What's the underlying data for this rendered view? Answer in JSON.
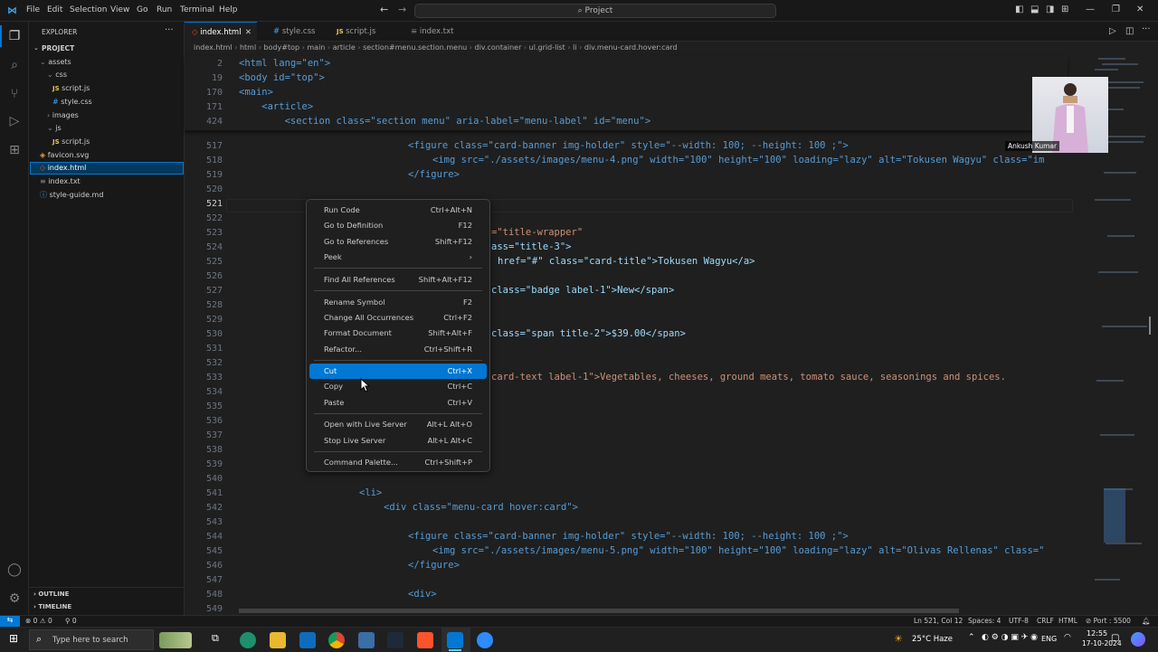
{
  "menubar": {
    "items": [
      "File",
      "Edit",
      "Selection",
      "View",
      "Go",
      "Run",
      "Terminal",
      "Help"
    ],
    "search": "Project"
  },
  "explorer": {
    "title": "EXPLORER",
    "project": "PROJECT",
    "items": [
      {
        "label": "assets",
        "kind": "folder"
      },
      {
        "label": "css",
        "kind": "folder"
      },
      {
        "label": "script.js",
        "kind": "js"
      },
      {
        "label": "style.css",
        "kind": "css"
      },
      {
        "label": "images",
        "kind": "folder"
      },
      {
        "label": "js",
        "kind": "folder"
      },
      {
        "label": "script.js",
        "kind": "js"
      },
      {
        "label": "favicon.svg",
        "kind": "svg"
      },
      {
        "label": "index.html",
        "kind": "html"
      },
      {
        "label": "index.txt",
        "kind": "txt"
      },
      {
        "label": "style-guide.md",
        "kind": "md"
      }
    ],
    "outline": "OUTLINE",
    "timeline": "TIMELINE"
  },
  "tabs": [
    "index.html",
    "style.css",
    "script.js",
    "index.txt"
  ],
  "breadcrumb": [
    "index.html",
    "html",
    "body#top",
    "main",
    "article",
    "section#menu.section.menu",
    "div.container",
    "ul.grid-list",
    "li",
    "div.menu-card.hover:card"
  ],
  "sticky": {
    "lines": [
      "2",
      "19",
      "170",
      "171",
      "424"
    ],
    "code": [
      "<html lang=\"en\">",
      "<body id=\"top\">",
      "<main>",
      "    <article>",
      "        <section class=\"section menu\" aria-label=\"menu-label\" id=\"menu\">"
    ]
  },
  "gutter": [
    "517",
    "518",
    "519",
    "520",
    "521",
    "522",
    "523",
    "524",
    "525",
    "526",
    "527",
    "528",
    "529",
    "530",
    "531",
    "532",
    "533",
    "534",
    "535",
    "536",
    "537",
    "538",
    "539",
    "540",
    "541",
    "542",
    "543",
    "544",
    "545",
    "546",
    "547",
    "548",
    "549"
  ],
  "code_lines": {
    "l517": "<figure class=\"card-banner img-holder\" style=\"--width: 100; --height: 100 ;\">",
    "l518": "<img src=\"./assets/images/menu-4.png\" width=\"100\" height=\"100\" loading=\"lazy\" alt=\"Tokusen Wagyu\" class=\"im",
    "l519": "</figure>",
    "l522": "=\"title-wrapper\"",
    "l523": "ass=\"title-3\">",
    "l524": "href=\"#\" class=\"card-title\">Tokusen Wagyu</a>",
    "l526": "class=\"badge label-1\">New</span>",
    "l529": "class=\"span title-2\">$39.00</span>",
    "l532": "card-text label-1\">Vegetables, cheeses, ground meats, tomato sauce, seasonings and spices.",
    "l540": "<li>",
    "l541": "<div class=\"menu-card hover:card\">",
    "l543": "<figure class=\"card-banner img-holder\" style=\"--width: 100; --height: 100 ;\">",
    "l544": "<img src=\"./assets/images/menu-5.png\" width=\"100\" height=\"100\" loading=\"lazy\" alt=\"Olivas Rellenas\" class=\"",
    "l545": "</figure>",
    "l547": "<div>"
  },
  "context_menu": [
    {
      "label": "Run Code",
      "key": "Ctrl+Alt+N"
    },
    {
      "label": "Go to Definition",
      "key": "F12"
    },
    {
      "label": "Go to References",
      "key": "Shift+F12"
    },
    {
      "label": "Peek",
      "key": ""
    },
    {
      "label": "Find All References",
      "key": "Shift+Alt+F12"
    },
    {
      "label": "Rename Symbol",
      "key": "F2"
    },
    {
      "label": "Change All Occurrences",
      "key": "Ctrl+F2"
    },
    {
      "label": "Format Document",
      "key": "Shift+Alt+F"
    },
    {
      "label": "Refactor...",
      "key": "Ctrl+Shift+R"
    },
    {
      "label": "Cut",
      "key": "Ctrl+X"
    },
    {
      "label": "Copy",
      "key": "Ctrl+C"
    },
    {
      "label": "Paste",
      "key": "Ctrl+V"
    },
    {
      "label": "Open with Live Server",
      "key": "Alt+L Alt+O"
    },
    {
      "label": "Stop Live Server",
      "key": "Alt+L Alt+C"
    },
    {
      "label": "Command Palette...",
      "key": "Ctrl+Shift+P"
    }
  ],
  "webcam": {
    "name": "Ankush Kumar"
  },
  "statusbar": {
    "errors": "0",
    "warnings": "0",
    "ports_left": "0",
    "position": "Ln 521, Col 12",
    "spaces": "Spaces: 4",
    "encoding": "UTF-8",
    "eol": "CRLF",
    "language": "HTML",
    "port": "Port : 5500"
  },
  "taskbar": {
    "search_placeholder": "Type here to search",
    "weather": "25°C Haze",
    "lang": "ENG",
    "time": "12:55",
    "date": "17-10-2024"
  },
  "colors": {
    "accent": "#0078d4",
    "tag": "#569cd6",
    "attr": "#9cdcfe",
    "string": "#ce9178"
  }
}
